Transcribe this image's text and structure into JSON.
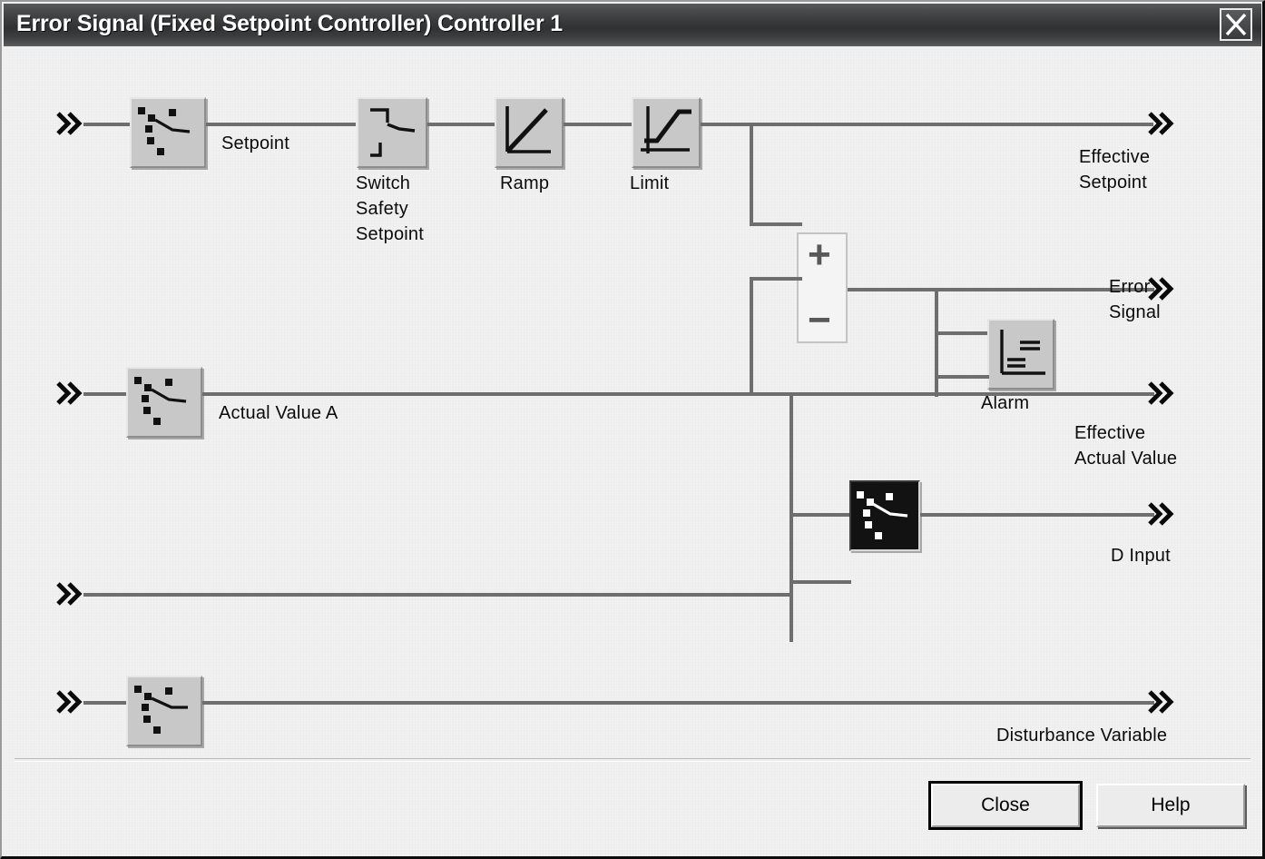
{
  "window": {
    "title": "Error Signal (Fixed Setpoint Controller) Controller 1",
    "close_icon": "close-icon"
  },
  "colors": {
    "titlebar_dark": "#3b3c3e",
    "client_bg": "#f1f1f1",
    "wire": "#6e6e6e",
    "block_face": "#c8c8c8",
    "block_dark_face": "#121212",
    "text": "#0b0b0b"
  },
  "diagram": {
    "inputs": [
      {
        "name": "setpoint-input",
        "arrow": "chevron-double-right-icon"
      },
      {
        "name": "actual-value-input",
        "arrow": "chevron-double-right-icon"
      },
      {
        "name": "d-input-secondary-input",
        "arrow": "chevron-double-right-icon"
      },
      {
        "name": "disturbance-input",
        "arrow": "chevron-double-right-icon"
      }
    ],
    "blocks": [
      {
        "id": "setpoint",
        "label": "Setpoint",
        "icon": "selector-switch-icon",
        "style": "light"
      },
      {
        "id": "switch-safety",
        "label": "Switch\nSafety\nSetpoint",
        "icon": "step-switch-icon",
        "style": "light"
      },
      {
        "id": "ramp",
        "label": "Ramp",
        "icon": "ramp-icon",
        "style": "light"
      },
      {
        "id": "limit",
        "label": "Limit",
        "icon": "limit-icon",
        "style": "light"
      },
      {
        "id": "alarm",
        "label": "Alarm",
        "icon": "alarm-threshold-icon",
        "style": "light"
      },
      {
        "id": "actual-value-a",
        "label": "Actual Value A",
        "icon": "selector-switch-icon",
        "style": "light"
      },
      {
        "id": "d-input-sel",
        "label": "",
        "icon": "selector-switch-icon",
        "style": "dark"
      },
      {
        "id": "disturbance",
        "label": "",
        "icon": "selector-switch-icon",
        "style": "light"
      }
    ],
    "summing_junction": {
      "name": "summing-junction",
      "plus": "+",
      "minus": "−"
    },
    "outputs": [
      {
        "id": "effective-setpoint",
        "label": "Effective\nSetpoint",
        "arrow": "chevron-double-right-icon"
      },
      {
        "id": "error-signal",
        "label": "Error\nSignal",
        "arrow": "chevron-double-right-icon"
      },
      {
        "id": "effective-actual-value",
        "label": "Effective\nActual Value",
        "arrow": "chevron-double-right-icon"
      },
      {
        "id": "d-input",
        "label": "D Input",
        "arrow": "chevron-double-right-icon"
      },
      {
        "id": "disturbance-variable",
        "label": "Disturbance Variable",
        "arrow": "chevron-double-right-icon"
      }
    ]
  },
  "footer": {
    "close_label": "Close",
    "help_label": "Help"
  }
}
